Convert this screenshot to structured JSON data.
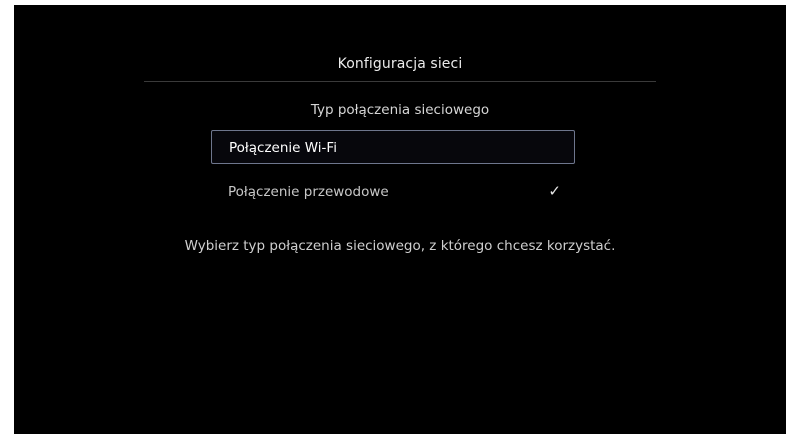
{
  "dialog": {
    "title": "Konfiguracja sieci",
    "subtitle": "Typ połączenia sieciowego",
    "options": [
      {
        "label": "Połączenie Wi-Fi",
        "focused": true,
        "selected": false
      },
      {
        "label": "Połączenie przewodowe",
        "focused": false,
        "selected": true,
        "check_glyph": "✓"
      }
    ],
    "hint": "Wybierz typ połączenia sieciowego, z którego chcesz korzystać."
  },
  "colors": {
    "background": "#000000",
    "focus_border": "#6e768d",
    "divider": "#3a3a3a"
  },
  "icons": {
    "selected": "checkmark-icon"
  }
}
